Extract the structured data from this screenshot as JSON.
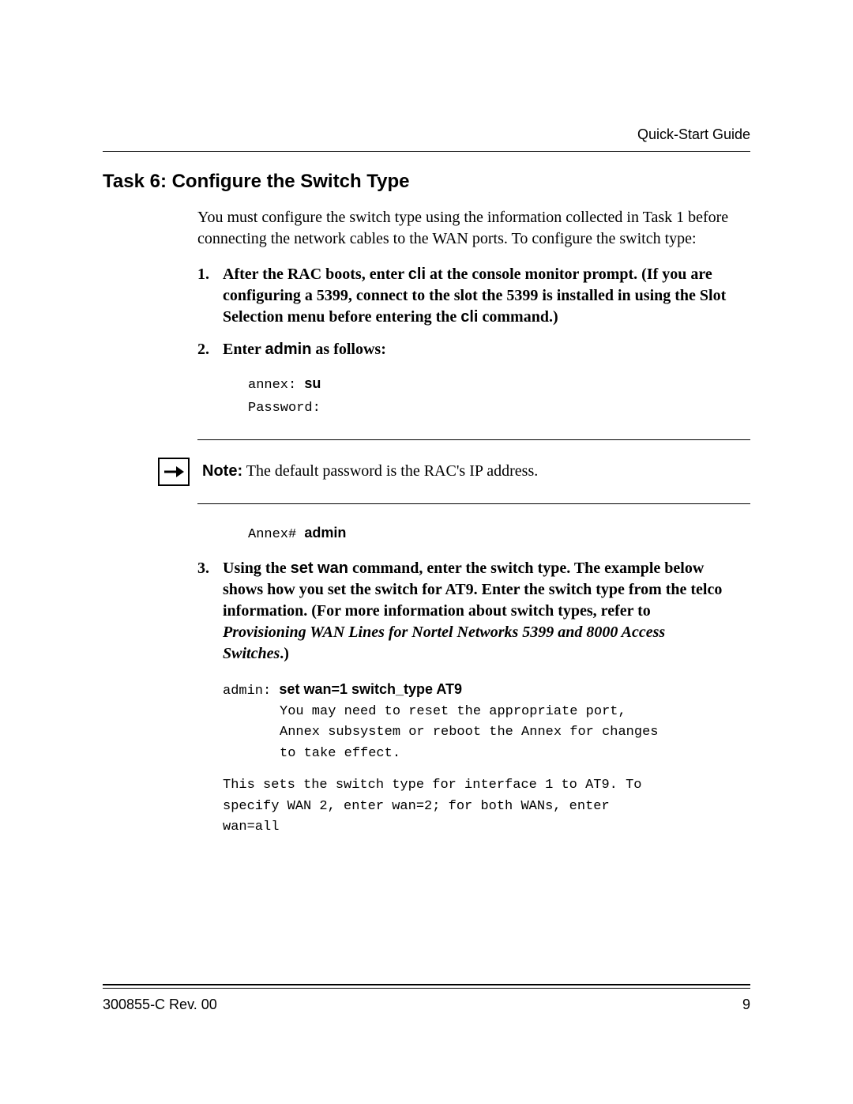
{
  "header": {
    "running_head": "Quick-Start Guide"
  },
  "section": {
    "title": "Task 6: Configure the Switch Type",
    "intro": "You must configure the switch type using the information collected in Task 1 before connecting the network cables to the WAN ports. To configure the switch type:"
  },
  "steps": {
    "s1": {
      "pre": "After the RAC boots, enter ",
      "cli1": "cli",
      "mid": " at the console monitor prompt. (If you are configuring a 5399, connect to the slot the 5399 is installed in using the Slot Selection menu before entering the ",
      "cli2": "cli",
      "post": " command.)"
    },
    "s2": {
      "pre": "Enter ",
      "admin": "admin",
      "post": " as follows:",
      "code": {
        "l1_prompt": "annex: ",
        "l1_cmd": "su",
        "l2": "Password:"
      }
    },
    "s3": {
      "pre": "Using the ",
      "setwan": "set wan",
      "mid": " command, enter the switch type. The example below shows how you set the switch for AT9. Enter the switch type from the telco information. (For more information about switch types, refer to ",
      "ital": "Provisioning WAN Lines for Nortel Networks 5399 and 8000 Access Switches",
      "post": ".)",
      "code": {
        "l1_prompt": "admin: ",
        "l1_cmd": "set wan=1 switch_type AT9",
        "l2": "You may need to reset the appropriate port,",
        "l3": "Annex subsystem or reboot the Annex for changes",
        "l4": "to take effect."
      },
      "explain": "This sets the switch type for interface 1 to AT9. To specify WAN 2, enter wan=2; for both WANs, enter wan=all"
    }
  },
  "note": {
    "label": "Note:",
    "text": " The default password is the RAC's IP address."
  },
  "after_note_code": {
    "prompt": "Annex# ",
    "cmd": "admin"
  },
  "footer": {
    "doc_id": "300855-C Rev. 00",
    "page": "9"
  }
}
